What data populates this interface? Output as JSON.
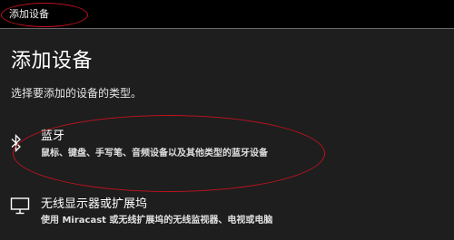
{
  "window": {
    "title": "添加设备"
  },
  "main": {
    "heading": "添加设备",
    "instruction": "选择要添加的设备的类型。"
  },
  "options": [
    {
      "icon": "bluetooth-icon",
      "title": "蓝牙",
      "description": "鼠标、键盘、手写笔、音频设备以及其他类型的蓝牙设备"
    },
    {
      "icon": "monitor-icon",
      "title": "无线显示器或扩展坞",
      "description": "使用 Miracast 或无线扩展坞的无线监视器、电视或电脑"
    }
  ],
  "annotations": {
    "color": "#c1121f"
  },
  "colors": {
    "titlebar_background": "#000000",
    "content_background": "#1e1e1e",
    "text": "#ffffff"
  }
}
